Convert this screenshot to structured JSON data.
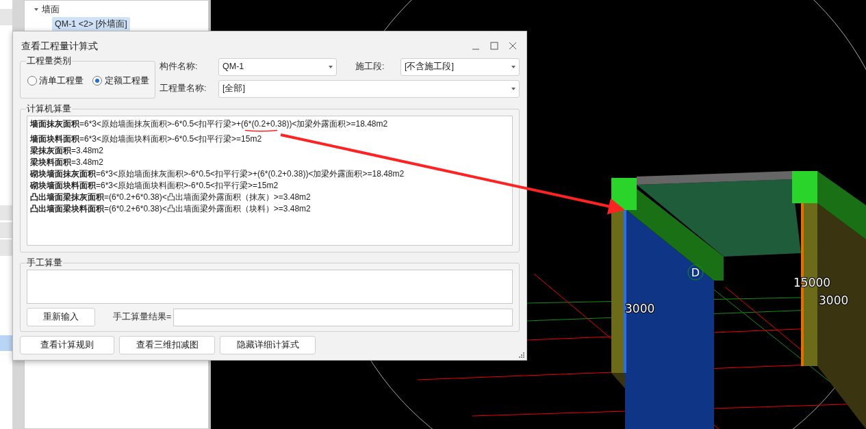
{
  "side_tabs": [
    {
      "selected": false
    },
    {
      "selected": false
    },
    {
      "selected": false
    },
    {
      "selected": false
    },
    {
      "selected": true
    }
  ],
  "tree": {
    "items": [
      {
        "label": "墙面",
        "expanded": true,
        "children": [
          {
            "label": "QM-1 <2> [外墙面]",
            "selected": true
          }
        ]
      }
    ]
  },
  "dialog": {
    "title": "查看工程量计算式",
    "quantity_type": {
      "label": "工程量类别",
      "options": [
        {
          "label": "清单工程量",
          "selected": false
        },
        {
          "label": "定额工程量",
          "selected": true
        }
      ]
    },
    "component_name": {
      "label": "构件名称:",
      "value": "QM-1"
    },
    "construction_stage": {
      "label": "施工段:",
      "value": "[不含施工段]"
    },
    "quantity_name": {
      "label": "工程量名称:",
      "value": "[全部]"
    },
    "computed": {
      "label": "计算机算量",
      "lines": [
        "**墙面抹灰面积**=6*3<原始墙面抹灰面积>-6*0.5<扣平行梁>+(6*(0.2+0.38))<加梁外露面积>=18.48m2",
        "**墙面块料面积**=6*3<原始墙面块料面积>-6*0.5<扣平行梁>=15m2",
        "**梁抹灰面积**=3.48m2",
        "**梁块料面积**=3.48m2",
        "**砌块墙面抹灰面积**=6*3<原始墙面抹灰面积>-6*0.5<扣平行梁>+(6*(0.2+0.38))<加梁外露面积>=18.48m2",
        "**砌块墙面块料面积**=6*3<原始墙面块料面积>-6*0.5<扣平行梁>=15m2",
        "**凸出墙面梁抹灰面积**=(6*0.2+6*0.38)<凸出墙面梁外露面积（抹灰）>=3.48m2",
        "**凸出墙面梁块料面积**=(6*0.2+6*0.38)<凸出墙面梁外露面积（块料）>=3.48m2"
      ]
    },
    "manual": {
      "label": "手工算量",
      "reenter_button": "重新输入",
      "result_label": "手工算量结果="
    },
    "buttons": [
      "查看计算规则",
      "查看三维扣减图",
      "隐藏详细计算式"
    ]
  },
  "viewport": {
    "axis_marker": "D",
    "dimension_labels": [
      "3000",
      "15000",
      "3000"
    ]
  }
}
